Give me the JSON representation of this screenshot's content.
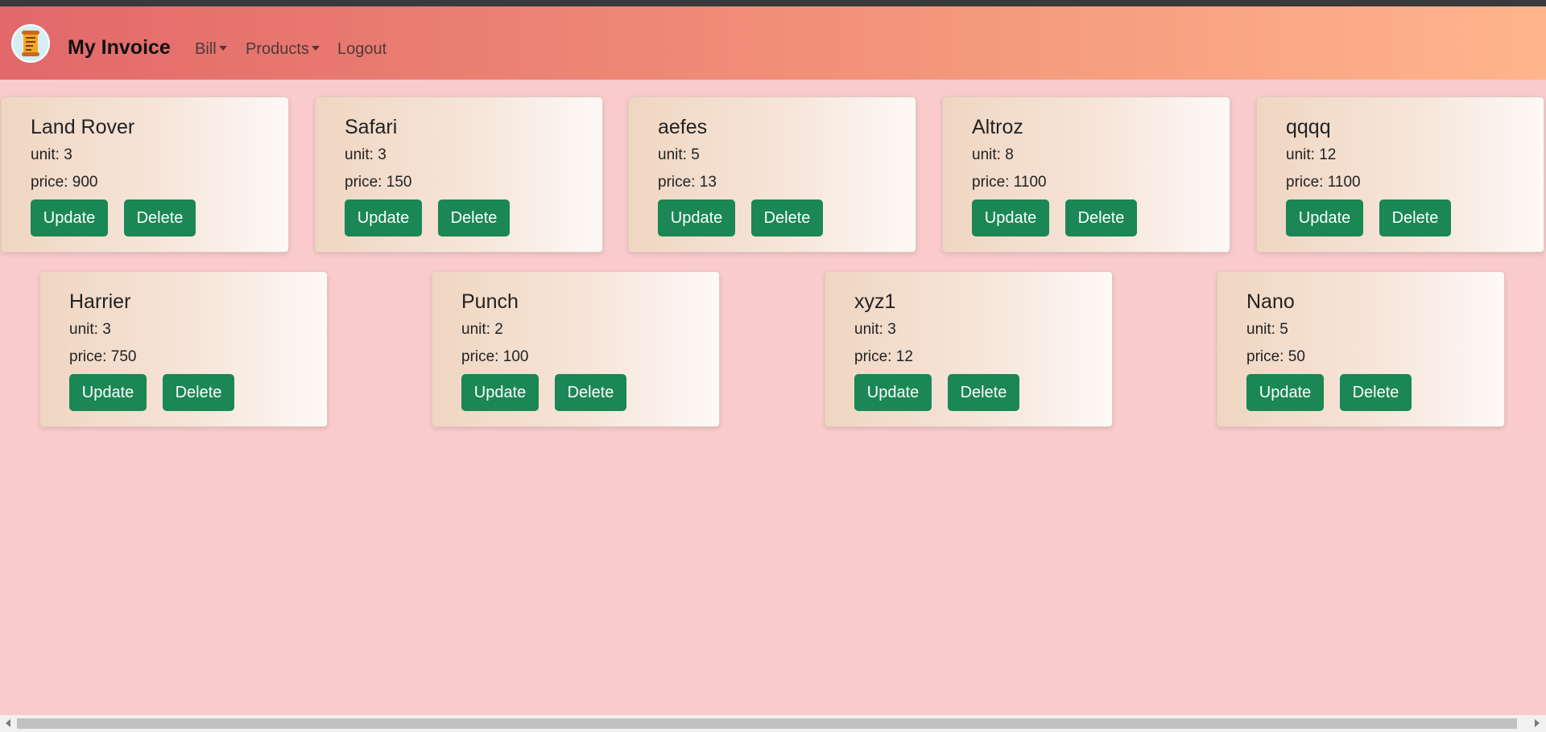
{
  "app": {
    "brand": "My Invoice",
    "logo_icon": "invoice-scroll-icon"
  },
  "nav": {
    "bill": "Bill",
    "products": "Products",
    "logout": "Logout"
  },
  "labels": {
    "unit": "unit: ",
    "price": "price: ",
    "update": "Update",
    "delete": "Delete"
  },
  "products": [
    {
      "name": "Land Rover",
      "unit": "3",
      "price": "900"
    },
    {
      "name": "Safari",
      "unit": "3",
      "price": "150"
    },
    {
      "name": "aefes",
      "unit": "5",
      "price": "13"
    },
    {
      "name": "Altroz",
      "unit": "8",
      "price": "1100"
    },
    {
      "name": "qqqq",
      "unit": "12",
      "price": "1100"
    },
    {
      "name": "Harrier",
      "unit": "3",
      "price": "750"
    },
    {
      "name": "Punch",
      "unit": "2",
      "price": "100"
    },
    {
      "name": "xyz1",
      "unit": "3",
      "price": "12"
    },
    {
      "name": "Nano",
      "unit": "5",
      "price": "50"
    }
  ],
  "colors": {
    "page_background": "#facbcc",
    "navbar_start": "#e2686a",
    "navbar_end": "#ffb58c",
    "button": "#1a8754"
  }
}
